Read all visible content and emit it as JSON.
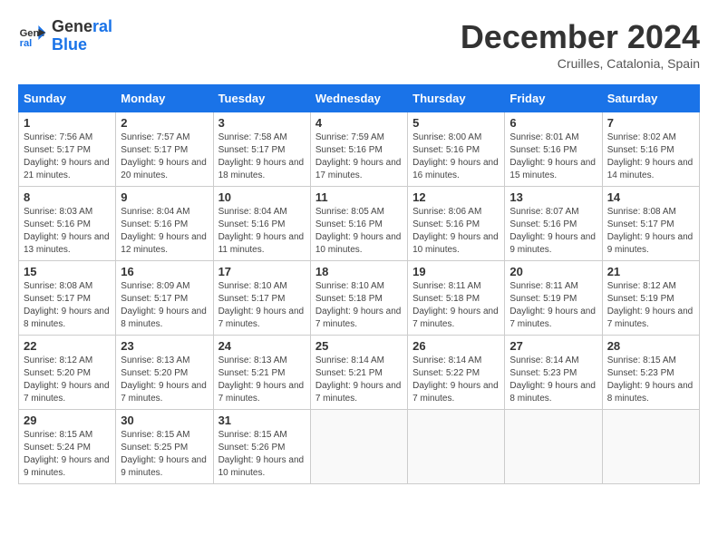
{
  "header": {
    "logo_text_general": "General",
    "logo_text_blue": "Blue",
    "month_year": "December 2024",
    "location": "Cruilles, Catalonia, Spain"
  },
  "calendar": {
    "days_of_week": [
      "Sunday",
      "Monday",
      "Tuesday",
      "Wednesday",
      "Thursday",
      "Friday",
      "Saturday"
    ],
    "weeks": [
      [
        {
          "day": "1",
          "sunrise": "7:56 AM",
          "sunset": "5:17 PM",
          "daylight": "9 hours and 21 minutes."
        },
        {
          "day": "2",
          "sunrise": "7:57 AM",
          "sunset": "5:17 PM",
          "daylight": "9 hours and 20 minutes."
        },
        {
          "day": "3",
          "sunrise": "7:58 AM",
          "sunset": "5:17 PM",
          "daylight": "9 hours and 18 minutes."
        },
        {
          "day": "4",
          "sunrise": "7:59 AM",
          "sunset": "5:16 PM",
          "daylight": "9 hours and 17 minutes."
        },
        {
          "day": "5",
          "sunrise": "8:00 AM",
          "sunset": "5:16 PM",
          "daylight": "9 hours and 16 minutes."
        },
        {
          "day": "6",
          "sunrise": "8:01 AM",
          "sunset": "5:16 PM",
          "daylight": "9 hours and 15 minutes."
        },
        {
          "day": "7",
          "sunrise": "8:02 AM",
          "sunset": "5:16 PM",
          "daylight": "9 hours and 14 minutes."
        }
      ],
      [
        {
          "day": "8",
          "sunrise": "8:03 AM",
          "sunset": "5:16 PM",
          "daylight": "9 hours and 13 minutes."
        },
        {
          "day": "9",
          "sunrise": "8:04 AM",
          "sunset": "5:16 PM",
          "daylight": "9 hours and 12 minutes."
        },
        {
          "day": "10",
          "sunrise": "8:04 AM",
          "sunset": "5:16 PM",
          "daylight": "9 hours and 11 minutes."
        },
        {
          "day": "11",
          "sunrise": "8:05 AM",
          "sunset": "5:16 PM",
          "daylight": "9 hours and 10 minutes."
        },
        {
          "day": "12",
          "sunrise": "8:06 AM",
          "sunset": "5:16 PM",
          "daylight": "9 hours and 10 minutes."
        },
        {
          "day": "13",
          "sunrise": "8:07 AM",
          "sunset": "5:16 PM",
          "daylight": "9 hours and 9 minutes."
        },
        {
          "day": "14",
          "sunrise": "8:08 AM",
          "sunset": "5:17 PM",
          "daylight": "9 hours and 9 minutes."
        }
      ],
      [
        {
          "day": "15",
          "sunrise": "8:08 AM",
          "sunset": "5:17 PM",
          "daylight": "9 hours and 8 minutes."
        },
        {
          "day": "16",
          "sunrise": "8:09 AM",
          "sunset": "5:17 PM",
          "daylight": "9 hours and 8 minutes."
        },
        {
          "day": "17",
          "sunrise": "8:10 AM",
          "sunset": "5:17 PM",
          "daylight": "9 hours and 7 minutes."
        },
        {
          "day": "18",
          "sunrise": "8:10 AM",
          "sunset": "5:18 PM",
          "daylight": "9 hours and 7 minutes."
        },
        {
          "day": "19",
          "sunrise": "8:11 AM",
          "sunset": "5:18 PM",
          "daylight": "9 hours and 7 minutes."
        },
        {
          "day": "20",
          "sunrise": "8:11 AM",
          "sunset": "5:19 PM",
          "daylight": "9 hours and 7 minutes."
        },
        {
          "day": "21",
          "sunrise": "8:12 AM",
          "sunset": "5:19 PM",
          "daylight": "9 hours and 7 minutes."
        }
      ],
      [
        {
          "day": "22",
          "sunrise": "8:12 AM",
          "sunset": "5:20 PM",
          "daylight": "9 hours and 7 minutes."
        },
        {
          "day": "23",
          "sunrise": "8:13 AM",
          "sunset": "5:20 PM",
          "daylight": "9 hours and 7 minutes."
        },
        {
          "day": "24",
          "sunrise": "8:13 AM",
          "sunset": "5:21 PM",
          "daylight": "9 hours and 7 minutes."
        },
        {
          "day": "25",
          "sunrise": "8:14 AM",
          "sunset": "5:21 PM",
          "daylight": "9 hours and 7 minutes."
        },
        {
          "day": "26",
          "sunrise": "8:14 AM",
          "sunset": "5:22 PM",
          "daylight": "9 hours and 7 minutes."
        },
        {
          "day": "27",
          "sunrise": "8:14 AM",
          "sunset": "5:23 PM",
          "daylight": "9 hours and 8 minutes."
        },
        {
          "day": "28",
          "sunrise": "8:15 AM",
          "sunset": "5:23 PM",
          "daylight": "9 hours and 8 minutes."
        }
      ],
      [
        {
          "day": "29",
          "sunrise": "8:15 AM",
          "sunset": "5:24 PM",
          "daylight": "9 hours and 9 minutes."
        },
        {
          "day": "30",
          "sunrise": "8:15 AM",
          "sunset": "5:25 PM",
          "daylight": "9 hours and 9 minutes."
        },
        {
          "day": "31",
          "sunrise": "8:15 AM",
          "sunset": "5:26 PM",
          "daylight": "9 hours and 10 minutes."
        },
        null,
        null,
        null,
        null
      ]
    ]
  }
}
